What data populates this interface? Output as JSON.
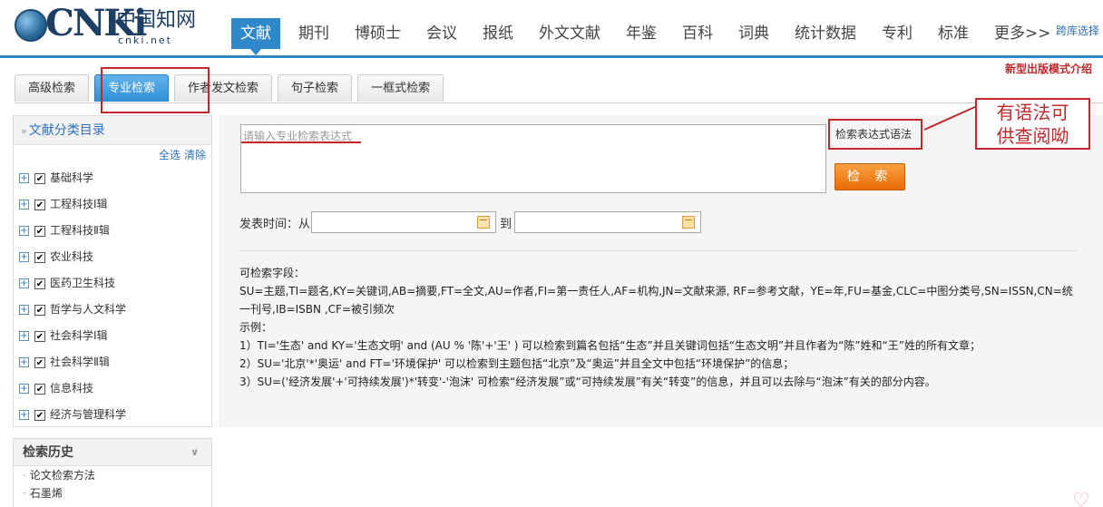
{
  "logo": {
    "cnki": "CNKi",
    "cn": "中国知网",
    "net": "cnki.net"
  },
  "nav": {
    "items": [
      "文献",
      "期刊",
      "博硕士",
      "会议",
      "报纸",
      "外文文献",
      "年鉴",
      "百科",
      "词典",
      "统计数据",
      "专利",
      "标准",
      "更多>>"
    ],
    "active": 0,
    "crosslib": "跨库选择"
  },
  "newpub": "新型出版模式介绍",
  "tabs": {
    "items": [
      "高级检索",
      "专业检索",
      "作者发文检索",
      "句子检索",
      "一框式检索"
    ],
    "active": 1
  },
  "sidebar": {
    "title": "文献分类目录",
    "select_all": "全选",
    "clear": "清除",
    "items": [
      "基础科学",
      "工程科技Ⅰ辑",
      "工程科技Ⅱ辑",
      "农业科技",
      "医药卫生科技",
      "哲学与人文科学",
      "社会科学Ⅰ辑",
      "社会科学Ⅱ辑",
      "信息科技",
      "经济与管理科学"
    ]
  },
  "history": {
    "title": "检索历史",
    "items": [
      "论文检索方法",
      "石墨烯"
    ]
  },
  "search": {
    "placeholder": "请输入专业检索表达式",
    "syntax_link": "检索表达式语法",
    "button": "检 索"
  },
  "date": {
    "label": "发表时间：从",
    "to": "到"
  },
  "callout": {
    "line1": "有语法可",
    "line2": "供查阅呦"
  },
  "help": {
    "fields_title": "可检索字段：",
    "fields": "SU=主题,TI=题名,KY=关键词,AB=摘要,FT=全文,AU=作者,FI=第一责任人,AF=机构,JN=文献来源, RF=参考文献，YE=年,FU=基金,CLC=中图分类号,SN=ISSN,CN=统一刊号,IB=ISBN ,CF=被引频次",
    "examples_title": "示例：",
    "examples": [
      "1）TI='生态' and KY='生态文明' and (AU % '陈'+'王' ) 可以检索到篇名包括“生态”并且关键词包括“生态文明”并且作者为“陈”姓和“王”姓的所有文章；",
      "2）SU='北京'*'奥运' and FT='环境保护' 可以检索到主题包括“北京”及“奥运”并且全文中包括“环境保护”的信息；",
      "3）SU=('经济发展'+'可持续发展')*'转变'-'泡沫' 可检索“经济发展”或“可持续发展”有关“转变”的信息，并且可以去除与“泡沫”有关的部分内容。"
    ]
  },
  "colors": {
    "accent": "#2f88c9",
    "annotation": "#c0282b",
    "button": "#ea6b06"
  }
}
